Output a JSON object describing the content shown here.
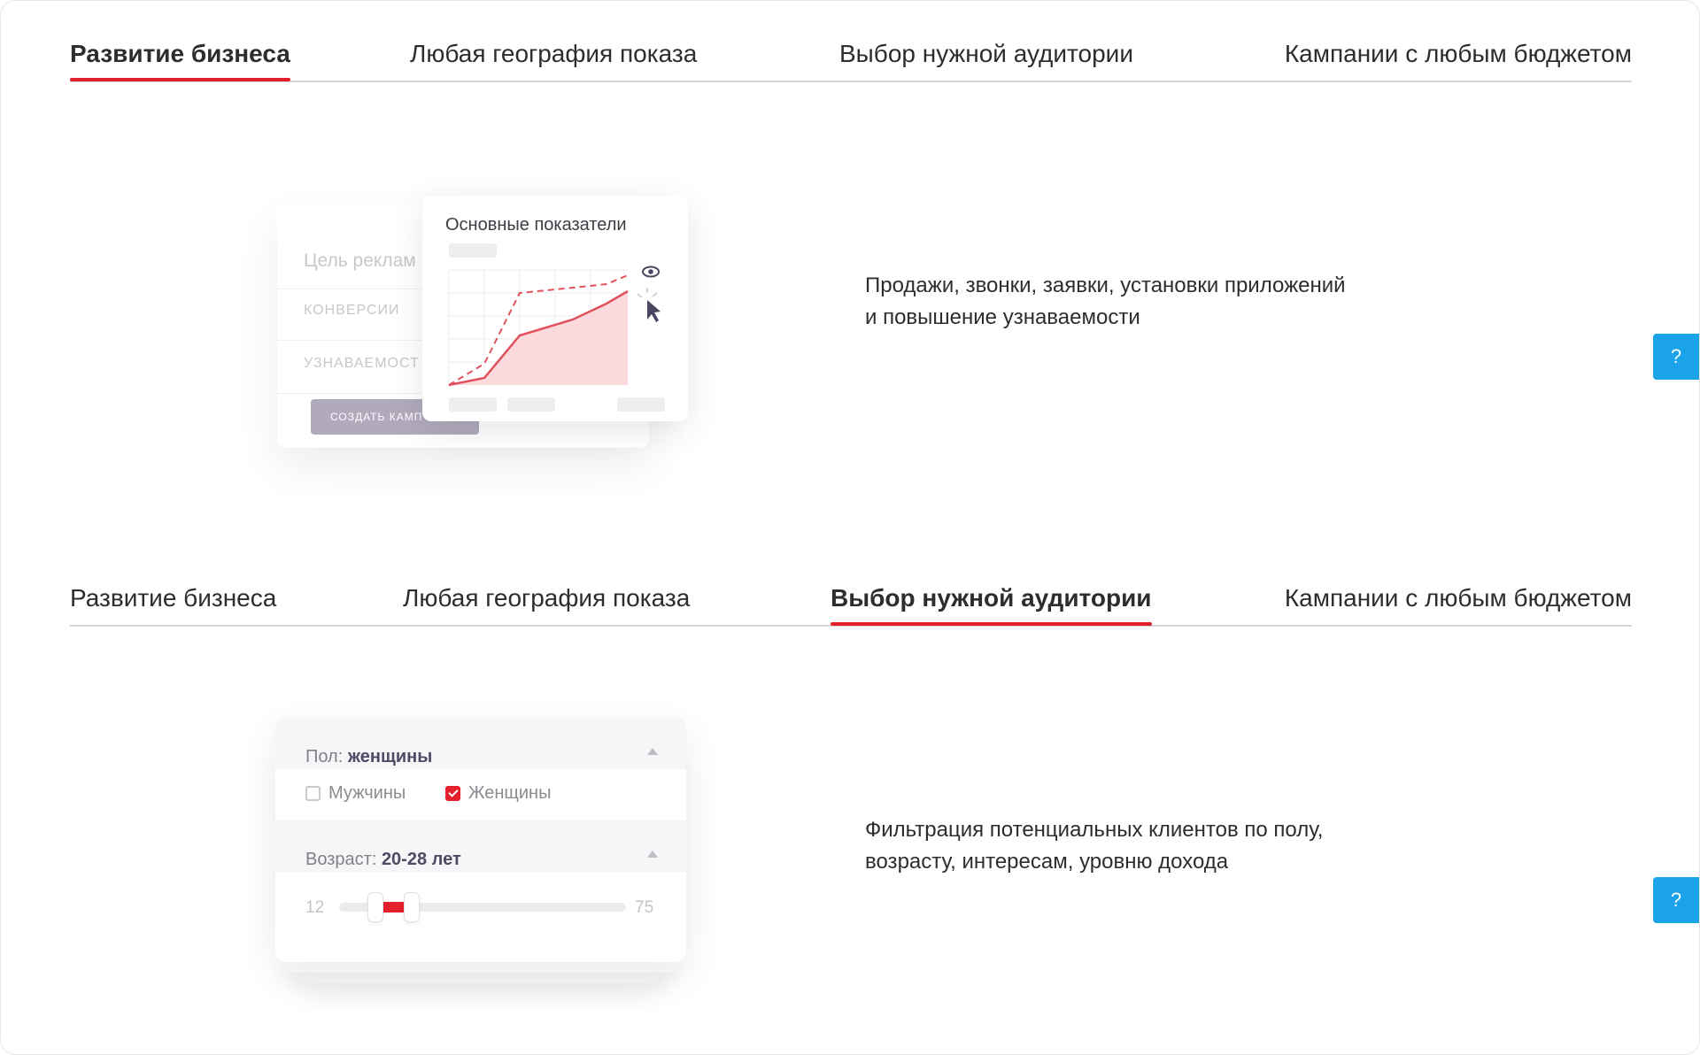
{
  "section1": {
    "tabs": [
      {
        "label": "Развитие бизнеса",
        "active": true
      },
      {
        "label": "Любая география показа",
        "active": false
      },
      {
        "label": "Выбор нужной аудитории",
        "active": false
      },
      {
        "label": "Кампании с любым бюджетом",
        "active": false
      }
    ],
    "description": {
      "line1": "Продажи, звонки, заявки, установки приложений",
      "line2": "и повышение узнаваемости"
    },
    "illustration": {
      "back_card": {
        "goal_label": "Цель реклам",
        "option1": "КОНВЕРСИИ",
        "option2": "УЗНАВАЕМОСТ",
        "create_button": "СОЗДАТЬ КАМП"
      },
      "chart_title": "Основные показатели"
    },
    "help_label": "?"
  },
  "section2": {
    "tabs": [
      {
        "label": "Развитие бизнеса",
        "active": false
      },
      {
        "label": "Любая география показа",
        "active": false
      },
      {
        "label": "Выбор нужной аудитории",
        "active": true
      },
      {
        "label": "Кампании с любым бюджетом",
        "active": false
      }
    ],
    "description": {
      "line1": "Фильтрация потенциальных клиентов по полу,",
      "line2": "возрасту, интересам, уровню дохода"
    },
    "illustration": {
      "gender_label": "Пол:",
      "gender_value": "женщины",
      "option_men": "Мужчины",
      "option_men_checked": false,
      "option_women": "Женщины",
      "option_women_checked": true,
      "age_label": "Возраст:",
      "age_value": "20-28 лет",
      "range_min": "12",
      "range_max": "75",
      "selected_min": 20,
      "selected_max": 28
    },
    "help_label": "?"
  },
  "colors": {
    "accent": "#e3202c",
    "help_button": "#1aa3e8",
    "tab_underline": "#d6d6d6",
    "muted_purple": "#b1aabd"
  }
}
